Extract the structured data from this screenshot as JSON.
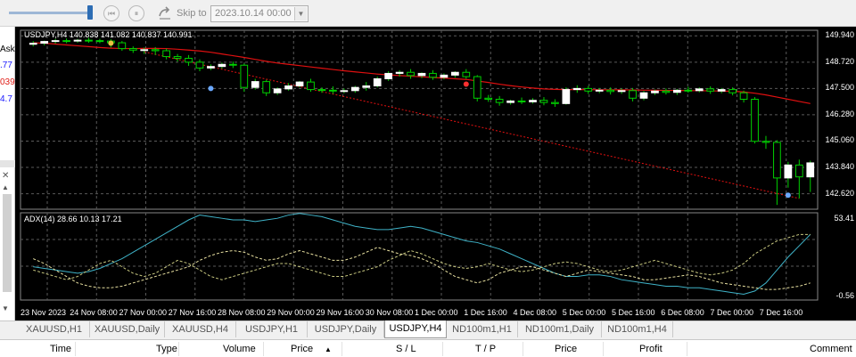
{
  "toolbar": {
    "skip_label": "Skip to",
    "skip_date": "2023.10.14 00:00"
  },
  "market_watch": {
    "header": "Ask",
    "values": [
      {
        "text": ".77",
        "color": "#1a1aff"
      },
      {
        "text": "039",
        "color": "#e0201a"
      },
      {
        "text": "4.7",
        "color": "#1a1aff"
      }
    ]
  },
  "chart": {
    "symbol_info": "USDJPY,H4  140.838 141.082 140.837 140.991",
    "indicator_info": "ADX(14) 28.66 10.13 17.21",
    "price_labels": [
      "149.940",
      "148.720",
      "147.500",
      "146.280",
      "145.060",
      "143.840",
      "142.620"
    ],
    "adx_labels": [
      "53.41",
      "-0.56"
    ],
    "time_labels": [
      "23 Nov 2023",
      "24 Nov 08:00",
      "27 Nov 00:00",
      "27 Nov 16:00",
      "28 Nov 08:00",
      "29 Nov 00:00",
      "29 Nov 16:00",
      "30 Nov 08:00",
      "1 Dec 00:00",
      "1 Dec 16:00",
      "4 Dec 08:00",
      "5 Dec 00:00",
      "5 Dec 16:00",
      "6 Dec 08:00",
      "7 Dec 00:00",
      "7 Dec 16:00"
    ],
    "colors": {
      "background": "#000000",
      "grid": "#5a5a5a",
      "bull": "#ffffff",
      "bear": "#000000",
      "wick": "#00d000",
      "ma": "#e01010",
      "adx": "#3fb3c8",
      "di_plus": "#e8e0a0",
      "di_minus": "#c8c880"
    }
  },
  "chart_data": {
    "type": "candlestick",
    "symbol": "USDJPY",
    "timeframe": "H4",
    "ylim": [
      141.9,
      150.2
    ],
    "candles": [
      {
        "o": 149.55,
        "h": 149.7,
        "c": 149.6,
        "l": 149.45
      },
      {
        "o": 149.6,
        "h": 149.72,
        "c": 149.68,
        "l": 149.5
      },
      {
        "o": 149.68,
        "h": 149.8,
        "c": 149.72,
        "l": 149.58
      },
      {
        "o": 149.72,
        "h": 149.82,
        "c": 149.7,
        "l": 149.6
      },
      {
        "o": 149.7,
        "h": 149.8,
        "c": 149.74,
        "l": 149.62
      },
      {
        "o": 149.74,
        "h": 149.85,
        "c": 149.72,
        "l": 149.62
      },
      {
        "o": 149.72,
        "h": 149.8,
        "c": 149.7,
        "l": 149.6
      },
      {
        "o": 149.7,
        "h": 149.78,
        "c": 149.62,
        "l": 149.4
      },
      {
        "o": 149.62,
        "h": 149.7,
        "c": 149.35,
        "l": 149.25
      },
      {
        "o": 149.35,
        "h": 149.45,
        "c": 149.28,
        "l": 149.15
      },
      {
        "o": 149.28,
        "h": 149.4,
        "c": 149.3,
        "l": 149.1
      },
      {
        "o": 149.3,
        "h": 149.42,
        "c": 149.25,
        "l": 149.05
      },
      {
        "o": 149.25,
        "h": 149.35,
        "c": 148.98,
        "l": 148.85
      },
      {
        "o": 148.98,
        "h": 149.1,
        "c": 148.9,
        "l": 148.75
      },
      {
        "o": 148.9,
        "h": 149.05,
        "c": 148.72,
        "l": 148.55
      },
      {
        "o": 148.72,
        "h": 148.85,
        "c": 148.45,
        "l": 148.3
      },
      {
        "o": 148.45,
        "h": 148.62,
        "c": 148.52,
        "l": 148.35
      },
      {
        "o": 148.52,
        "h": 148.7,
        "c": 148.62,
        "l": 148.42
      },
      {
        "o": 148.62,
        "h": 148.75,
        "c": 148.58,
        "l": 148.45
      },
      {
        "o": 148.58,
        "h": 148.65,
        "c": 147.55,
        "l": 147.35
      },
      {
        "o": 147.55,
        "h": 147.95,
        "c": 147.82,
        "l": 147.45
      },
      {
        "o": 147.82,
        "h": 147.9,
        "c": 147.3,
        "l": 147.15
      },
      {
        "o": 147.3,
        "h": 147.55,
        "c": 147.48,
        "l": 147.2
      },
      {
        "o": 147.48,
        "h": 147.75,
        "c": 147.62,
        "l": 147.4
      },
      {
        "o": 147.62,
        "h": 147.85,
        "c": 147.8,
        "l": 147.55
      },
      {
        "o": 147.8,
        "h": 147.95,
        "c": 147.45,
        "l": 147.35
      },
      {
        "o": 147.45,
        "h": 147.55,
        "c": 147.42,
        "l": 147.3
      },
      {
        "o": 147.42,
        "h": 147.6,
        "c": 147.38,
        "l": 147.25
      },
      {
        "o": 147.38,
        "h": 147.5,
        "c": 147.4,
        "l": 147.28
      },
      {
        "o": 147.4,
        "h": 147.62,
        "c": 147.55,
        "l": 147.3
      },
      {
        "o": 147.55,
        "h": 147.8,
        "c": 147.62,
        "l": 147.4
      },
      {
        "o": 147.62,
        "h": 148.05,
        "c": 147.95,
        "l": 147.55
      },
      {
        "o": 147.95,
        "h": 148.3,
        "c": 148.2,
        "l": 147.85
      },
      {
        "o": 148.2,
        "h": 148.35,
        "c": 148.25,
        "l": 148.05
      },
      {
        "o": 148.25,
        "h": 148.4,
        "c": 148.1,
        "l": 147.95
      },
      {
        "o": 148.1,
        "h": 148.25,
        "c": 148.2,
        "l": 147.98
      },
      {
        "o": 148.2,
        "h": 148.35,
        "c": 148.02,
        "l": 147.9
      },
      {
        "o": 148.02,
        "h": 148.2,
        "c": 148.12,
        "l": 147.92
      },
      {
        "o": 148.12,
        "h": 148.3,
        "c": 148.25,
        "l": 148.0
      },
      {
        "o": 148.25,
        "h": 148.4,
        "c": 148.05,
        "l": 147.95
      },
      {
        "o": 148.05,
        "h": 148.12,
        "c": 147.05,
        "l": 146.9
      },
      {
        "o": 147.05,
        "h": 147.2,
        "c": 147.0,
        "l": 146.88
      },
      {
        "o": 147.0,
        "h": 147.15,
        "c": 146.85,
        "l": 146.7
      },
      {
        "o": 146.85,
        "h": 146.98,
        "c": 146.92,
        "l": 146.75
      },
      {
        "o": 146.92,
        "h": 147.08,
        "c": 146.88,
        "l": 146.78
      },
      {
        "o": 146.88,
        "h": 147.05,
        "c": 146.95,
        "l": 146.8
      },
      {
        "o": 146.95,
        "h": 147.1,
        "c": 146.85,
        "l": 146.72
      },
      {
        "o": 146.85,
        "h": 147.0,
        "c": 146.8,
        "l": 146.65
      },
      {
        "o": 146.8,
        "h": 147.55,
        "c": 147.45,
        "l": 146.75
      },
      {
        "o": 147.45,
        "h": 147.65,
        "c": 147.5,
        "l": 147.3
      },
      {
        "o": 147.5,
        "h": 147.62,
        "c": 147.38,
        "l": 147.25
      },
      {
        "o": 147.38,
        "h": 147.52,
        "c": 147.42,
        "l": 147.28
      },
      {
        "o": 147.42,
        "h": 147.55,
        "c": 147.36,
        "l": 147.22
      },
      {
        "o": 147.36,
        "h": 147.5,
        "c": 147.4,
        "l": 147.25
      },
      {
        "o": 147.4,
        "h": 147.52,
        "c": 147.05,
        "l": 146.9
      },
      {
        "o": 147.05,
        "h": 147.38,
        "c": 147.3,
        "l": 146.95
      },
      {
        "o": 147.3,
        "h": 147.45,
        "c": 147.38,
        "l": 147.2
      },
      {
        "o": 147.38,
        "h": 147.5,
        "c": 147.32,
        "l": 147.22
      },
      {
        "o": 147.32,
        "h": 147.48,
        "c": 147.42,
        "l": 147.2
      },
      {
        "o": 147.42,
        "h": 147.58,
        "c": 147.4,
        "l": 147.3
      },
      {
        "o": 147.4,
        "h": 147.55,
        "c": 147.48,
        "l": 147.32
      },
      {
        "o": 147.48,
        "h": 147.6,
        "c": 147.38,
        "l": 147.25
      },
      {
        "o": 147.38,
        "h": 147.52,
        "c": 147.45,
        "l": 147.28
      },
      {
        "o": 147.45,
        "h": 147.55,
        "c": 147.3,
        "l": 147.18
      },
      {
        "o": 147.3,
        "h": 147.4,
        "c": 147.0,
        "l": 146.85
      },
      {
        "o": 147.0,
        "h": 147.1,
        "c": 145.05,
        "l": 144.95
      },
      {
        "o": 145.05,
        "h": 145.3,
        "c": 145.0,
        "l": 144.7
      },
      {
        "o": 145.0,
        "h": 145.1,
        "c": 143.35,
        "l": 142.1
      },
      {
        "o": 143.35,
        "h": 144.1,
        "c": 143.95,
        "l": 142.9
      },
      {
        "o": 143.95,
        "h": 144.2,
        "c": 143.4,
        "l": 142.4
      },
      {
        "o": 143.4,
        "h": 144.15,
        "c": 144.05,
        "l": 142.7
      }
    ],
    "moving_average": [
      149.62,
      149.6,
      149.56,
      149.52,
      149.48,
      149.44,
      149.4,
      149.37,
      149.35,
      149.35,
      149.36,
      149.36,
      149.35,
      149.32,
      149.28,
      149.24,
      149.18,
      149.1,
      149.02,
      148.94,
      148.85,
      148.76,
      148.68,
      148.62,
      148.56,
      148.5,
      148.44,
      148.38,
      148.32,
      148.27,
      148.22,
      148.17,
      148.13,
      148.1,
      148.07,
      148.04,
      148.01,
      147.98,
      147.95,
      147.92,
      147.85,
      147.78,
      147.7,
      147.63,
      147.57,
      147.52,
      147.48,
      147.46,
      147.45,
      147.45,
      147.45,
      147.44,
      147.44,
      147.44,
      147.43,
      147.42,
      147.42,
      147.41,
      147.41,
      147.4,
      147.4,
      147.39,
      147.38,
      147.37,
      147.34,
      147.28,
      147.2,
      147.1,
      147.0,
      146.9,
      146.8
    ],
    "adx": [
      20,
      19,
      18,
      17,
      16,
      17,
      19,
      22,
      25,
      29,
      33,
      37,
      41,
      45,
      49,
      52,
      51,
      50,
      49,
      49,
      48,
      49,
      50,
      52,
      53,
      52,
      51,
      49,
      47,
      45,
      44,
      43,
      43,
      44,
      45,
      44,
      42,
      40,
      38,
      36,
      35,
      33,
      31,
      28,
      25,
      22,
      19,
      16,
      14,
      14,
      15,
      15,
      14,
      12,
      11,
      10,
      9,
      8,
      8,
      7,
      7,
      6,
      5,
      4,
      3,
      5,
      10,
      18,
      26,
      33,
      40
    ],
    "di_plus": [
      25,
      22,
      18,
      14,
      10,
      8,
      7,
      7,
      8,
      10,
      12,
      14,
      16,
      18,
      20,
      24,
      27,
      29,
      30,
      29,
      26,
      24,
      25,
      28,
      30,
      28,
      26,
      24,
      24,
      26,
      29,
      32,
      30,
      28,
      27,
      25,
      22,
      18,
      14,
      12,
      10,
      12,
      16,
      18,
      20,
      20,
      18,
      16,
      14,
      16,
      18,
      17,
      16,
      15,
      14,
      12,
      12,
      13,
      14,
      15,
      14,
      12,
      10,
      9,
      8,
      7,
      6,
      6,
      7,
      8,
      10
    ],
    "di_minus": [
      18,
      16,
      14,
      12,
      14,
      18,
      22,
      24,
      20,
      16,
      14,
      16,
      20,
      24,
      22,
      18,
      14,
      12,
      14,
      16,
      18,
      20,
      22,
      22,
      20,
      18,
      16,
      14,
      14,
      16,
      18,
      20,
      24,
      27,
      30,
      28,
      25,
      22,
      20,
      19,
      20,
      22,
      20,
      18,
      17,
      18,
      20,
      22,
      23,
      22,
      20,
      18,
      17,
      18,
      20,
      22,
      24,
      22,
      20,
      18,
      16,
      15,
      16,
      18,
      22,
      28,
      32,
      36,
      38,
      40,
      40
    ],
    "adx_ylim": [
      -0.56,
      53.41
    ]
  },
  "tabs": [
    {
      "label": "XAUUSD,H1",
      "active": false
    },
    {
      "label": "XAUUSD,Daily",
      "active": false
    },
    {
      "label": "XAUUSD,H4",
      "active": false
    },
    {
      "label": "USDJPY,H1",
      "active": false
    },
    {
      "label": "USDJPY,Daily",
      "active": false
    },
    {
      "label": "USDJPY,H4",
      "active": true
    },
    {
      "label": "ND100m1,H1",
      "active": false
    },
    {
      "label": "ND100m1,Daily",
      "active": false
    },
    {
      "label": "ND100m1,H4",
      "active": false
    }
  ],
  "table_header": {
    "columns": [
      "Time",
      "Type",
      "Volume",
      "Price",
      "S / L",
      "T / P",
      "Price",
      "Profit",
      "Comment"
    ],
    "sort_indicator": "▲"
  }
}
